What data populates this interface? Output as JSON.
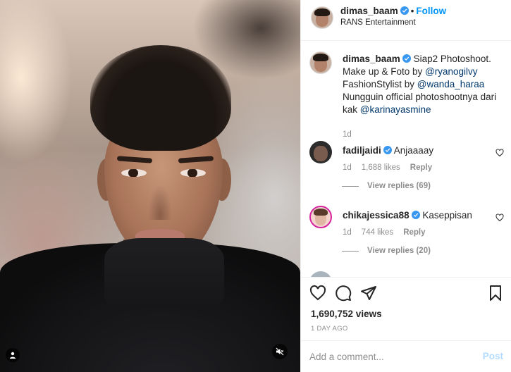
{
  "header": {
    "username": "dimas_baam",
    "separator": "•",
    "follow_label": "Follow",
    "subtitle": "RANS Entertainment"
  },
  "caption": {
    "username": "dimas_baam",
    "text_1": "Siap2 Photoshoot. Make up & Foto by ",
    "mention_1": "@ryanogilvy",
    "text_2": " FashionStylist by ",
    "mention_2": "@wanda_haraa",
    "text_3": " Nungguin official photoshootnya dari kak ",
    "mention_3": "@karinayasmine",
    "age": "1d"
  },
  "comments": [
    {
      "username": "fadiljaidi",
      "verified": true,
      "text": "Anjaaaay",
      "age": "1d",
      "likes": "1,688 likes",
      "reply_label": "Reply",
      "view_replies": "View replies (69)"
    },
    {
      "username": "chikajessica88",
      "verified": true,
      "text": "Kaseppisan",
      "age": "1d",
      "likes": "744 likes",
      "reply_label": "Reply",
      "view_replies": "View replies (20)"
    }
  ],
  "actions": {
    "views": "1,690,752 views",
    "date": "1 DAY AGO"
  },
  "comment_box": {
    "placeholder": "Add a comment...",
    "post_label": "Post"
  },
  "icons": {
    "verified": "verified-badge-icon",
    "like": "heart-icon",
    "comment": "comment-bubble-icon",
    "share": "paper-plane-icon",
    "save": "bookmark-icon",
    "tag": "user-tag-icon",
    "mute": "speaker-muted-icon"
  },
  "colors": {
    "accent": "#0095f6",
    "verified": "#3897f0",
    "mention": "#00376b",
    "muted_text": "#8e8e8e",
    "post_disabled": "#b3dbff"
  }
}
